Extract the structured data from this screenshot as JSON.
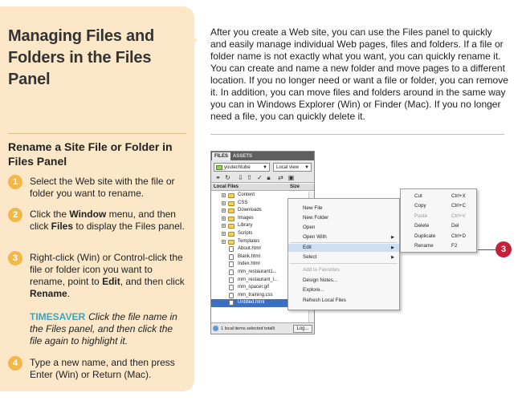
{
  "title": "Managing Files and Folders in the Files Panel",
  "section_heading": "Rename a Site File or Folder in Files Panel",
  "intro": "After you create a Web site, you can use the Files panel to quickly and easily manage individual Web pages, files and folders. If a file or folder name is not exactly what you want, you can quickly rename it. You can create and name a new folder and move pages to a different location. If you no longer need or want a file or folder, you can remove it. In addition, you can move files and folders around in the same way you can in Windows Explorer (Win) or Finder (Mac). If you no longer need a file, you can quickly delete it.",
  "steps": [
    {
      "num": "1",
      "parts": [
        {
          "t": "Select the Web site with the file or folder you want to rename."
        }
      ]
    },
    {
      "num": "2",
      "parts": [
        {
          "t": "Click the "
        },
        {
          "t": "Window",
          "b": true
        },
        {
          "t": " menu, and then click "
        },
        {
          "t": "Files",
          "b": true
        },
        {
          "t": " to display the Files panel."
        }
      ]
    },
    {
      "num": "3",
      "parts": [
        {
          "t": "Right-click (Win) or Control-click the file or folder icon you want to rename, point to "
        },
        {
          "t": "Edit",
          "b": true
        },
        {
          "t": ", and then click "
        },
        {
          "t": "Rename",
          "b": true
        },
        {
          "t": "."
        }
      ]
    },
    {
      "num": "4",
      "parts": [
        {
          "t": "Type a new name, and then press Enter (Win) or Return (Mac)."
        }
      ]
    }
  ],
  "timesaver": {
    "label": "TIMESAVER",
    "text": "Click the file name in the Files panel, and then click the file again to highlight it."
  },
  "screenshot": {
    "tabs": [
      "FILES",
      "ASSETS"
    ],
    "site_select": "youtechtube",
    "view_select": "Local view",
    "header_left": "Local Files",
    "header_right": "Size",
    "files": [
      {
        "name": "Content",
        "type": "folder",
        "expandable": true
      },
      {
        "name": "CSS",
        "type": "folder",
        "expandable": true
      },
      {
        "name": "Downloads",
        "type": "folder",
        "expandable": true
      },
      {
        "name": "Images",
        "type": "folder",
        "expandable": true
      },
      {
        "name": "Library",
        "type": "folder",
        "expandable": true
      },
      {
        "name": "Scripts",
        "type": "folder",
        "expandable": true
      },
      {
        "name": "Templates",
        "type": "folder",
        "expandable": true
      },
      {
        "name": "About.html",
        "type": "doc"
      },
      {
        "name": "Blank.html",
        "type": "doc"
      },
      {
        "name": "Index.html",
        "type": "doc"
      },
      {
        "name": "mm_restaurant1...",
        "type": "doc"
      },
      {
        "name": "mm_restaurant_l...",
        "type": "doc"
      },
      {
        "name": "mm_spacer.gif",
        "type": "doc"
      },
      {
        "name": "mm_training.css",
        "type": "doc"
      },
      {
        "name": "Untitled.html",
        "type": "doc",
        "selected": true
      }
    ],
    "status": "1 local items selected totalli",
    "log_button": "Log...",
    "context_menu": [
      {
        "label": "New File"
      },
      {
        "label": "New Folder"
      },
      {
        "label": "Open"
      },
      {
        "label": "Open With",
        "submenu": true
      },
      {
        "label": "Edit",
        "submenu": true,
        "active": true
      },
      {
        "label": "Select",
        "submenu": true
      },
      {
        "label": "Add to Favorites",
        "disabled": true
      },
      {
        "label": "Design Notes..."
      },
      {
        "label": "Explore..."
      },
      {
        "label": "Refresh Local Files"
      }
    ],
    "edit_submenu": [
      {
        "label": "Cut",
        "shortcut": "Ctrl+X"
      },
      {
        "label": "Copy",
        "shortcut": "Ctrl+C"
      },
      {
        "label": "Paste",
        "shortcut": "Ctrl+V",
        "disabled": true
      },
      {
        "label": "Delete",
        "shortcut": "Del"
      },
      {
        "label": "Duplicate",
        "shortcut": "Ctrl+D"
      },
      {
        "label": "Rename",
        "shortcut": "F2"
      }
    ],
    "callout": "3"
  },
  "colors": {
    "sidebar_bg": "#fce8c8",
    "step_badge": "#f2b94a",
    "timesaver_label": "#39a6bd",
    "callout": "#c4213a",
    "rule": "#e3b985"
  }
}
